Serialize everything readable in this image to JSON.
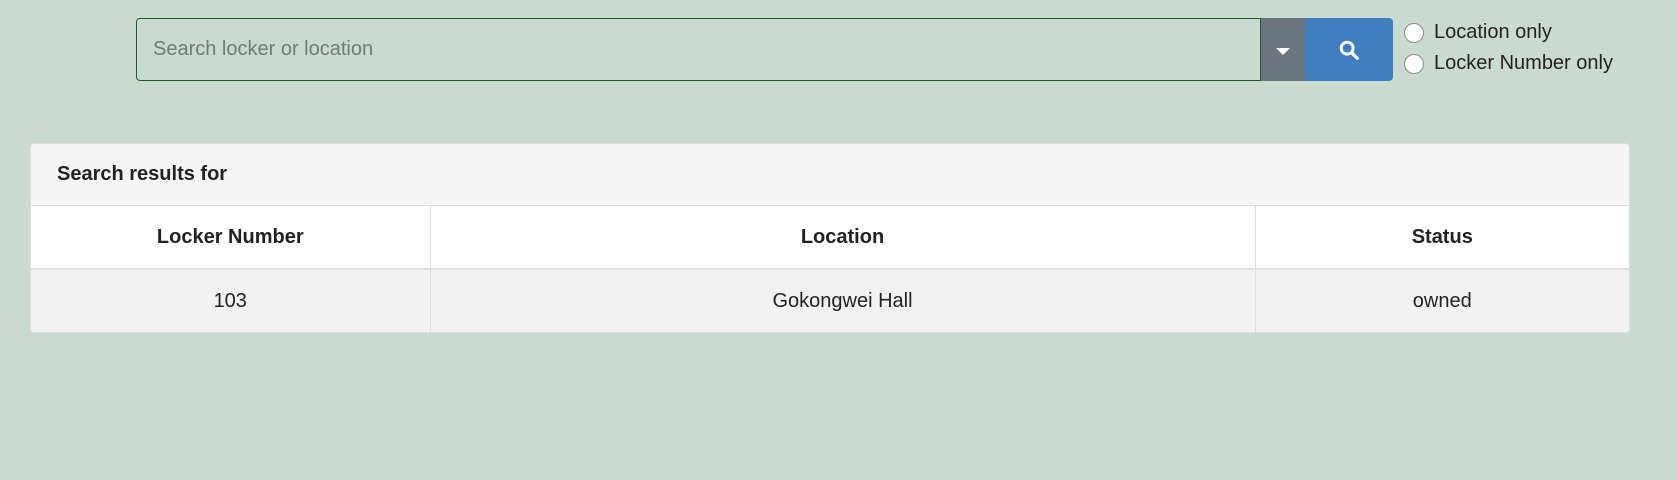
{
  "search": {
    "placeholder": "Search locker or location",
    "value": ""
  },
  "filters": {
    "options": [
      {
        "label": "Location only",
        "selected": false
      },
      {
        "label": "Locker Number only",
        "selected": false
      }
    ]
  },
  "results": {
    "heading": "Search results for",
    "columns": [
      "Locker Number",
      "Location",
      "Status"
    ],
    "rows": [
      {
        "locker_number": "103",
        "location": "Gokongwei Hall",
        "status": "owned"
      }
    ]
  },
  "icons": {
    "dropdown": "caret-down-icon",
    "search": "search-icon"
  },
  "colors": {
    "background": "#c9dbd1",
    "search_button": "#3f7fc0",
    "dropdown_button": "#6c757d",
    "input_border": "#1e5a2a"
  }
}
